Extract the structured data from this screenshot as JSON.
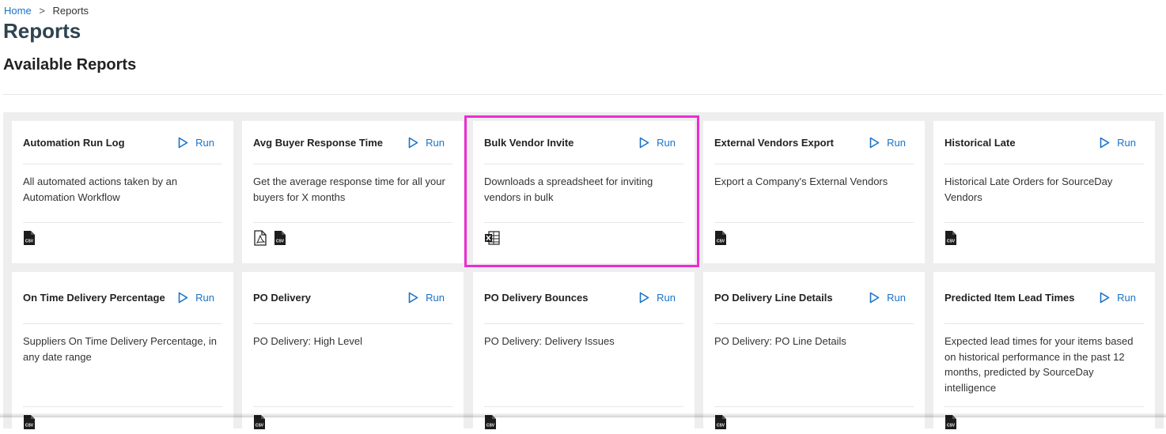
{
  "breadcrumb": {
    "home": "Home",
    "separator": ">",
    "current": "Reports"
  },
  "page_title": "Reports",
  "section_title": "Available Reports",
  "run_label": "Run",
  "colors": {
    "accent": "#1a73c8",
    "highlight": "#ee2bd3",
    "title": "#2e4450"
  },
  "reports": [
    {
      "title": "Automation Run Log",
      "description": "All automated actions taken by an Automation Workflow",
      "formats": [
        "csv"
      ]
    },
    {
      "title": "Avg Buyer Response Time",
      "description": "Get the average response time for all your buyers for X months",
      "formats": [
        "pdf",
        "csv"
      ]
    },
    {
      "title": "Bulk Vendor Invite",
      "description": "Downloads a spreadsheet for inviting vendors in bulk",
      "formats": [
        "xls"
      ]
    },
    {
      "title": "External Vendors Export",
      "description": "Export a Company's External Vendors",
      "formats": [
        "csv"
      ]
    },
    {
      "title": "Historical Late",
      "description": "Historical Late Orders for SourceDay Vendors",
      "formats": [
        "csv"
      ]
    },
    {
      "title": "On Time Delivery Percentage",
      "description": "Suppliers On Time Delivery Percentage, in any date range",
      "formats": [
        "csv"
      ]
    },
    {
      "title": "PO Delivery",
      "description": "PO Delivery: High Level",
      "formats": [
        "csv"
      ]
    },
    {
      "title": "PO Delivery Bounces",
      "description": "PO Delivery: Delivery Issues",
      "formats": [
        "csv"
      ]
    },
    {
      "title": "PO Delivery Line Details",
      "description": "PO Delivery: PO Line Details",
      "formats": [
        "csv"
      ]
    },
    {
      "title": "Predicted Item Lead Times",
      "description": "Expected lead times for your items based on historical performance in the past 12 months, predicted by SourceDay intelligence",
      "formats": [
        "csv"
      ]
    }
  ]
}
